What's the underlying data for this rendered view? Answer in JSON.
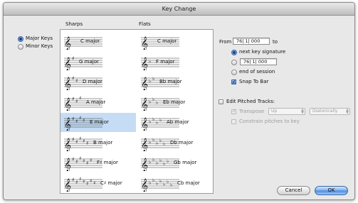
{
  "window": {
    "title": "Key Change"
  },
  "mode": {
    "options": [
      {
        "label": "Major Keys",
        "selected": true
      },
      {
        "label": "Minor Keys",
        "selected": false
      }
    ]
  },
  "list": {
    "headers": {
      "sharps": "Sharps",
      "flats": "Flats"
    },
    "sharps": [
      {
        "label": "C major",
        "accidentals": 0,
        "selected": false
      },
      {
        "label": "G major",
        "accidentals": 1,
        "selected": false
      },
      {
        "label": "D major",
        "accidentals": 2,
        "selected": false
      },
      {
        "label": "A major",
        "accidentals": 3,
        "selected": false
      },
      {
        "label": "E major",
        "accidentals": 4,
        "selected": true
      },
      {
        "label": "B major",
        "accidentals": 5,
        "selected": false
      },
      {
        "label": "F♯ major",
        "accidentals": 6,
        "selected": false
      },
      {
        "label": "C♯ major",
        "accidentals": 7,
        "selected": false
      }
    ],
    "flats": [
      {
        "label": "C major",
        "accidentals": 0,
        "selected": false
      },
      {
        "label": "F major",
        "accidentals": 1,
        "selected": false
      },
      {
        "label": "Bb major",
        "accidentals": 2,
        "selected": false
      },
      {
        "label": "Eb major",
        "accidentals": 3,
        "selected": false
      },
      {
        "label": "Ab major",
        "accidentals": 4,
        "selected": false
      },
      {
        "label": "Db major",
        "accidentals": 5,
        "selected": false
      },
      {
        "label": "Gb major",
        "accidentals": 6,
        "selected": false
      },
      {
        "label": "Cb major",
        "accidentals": 7,
        "selected": false
      }
    ],
    "sharp_symbol": "♯",
    "flat_symbol": "♭",
    "clef_symbol": "𝄞",
    "selection_color": "#c5dcf4"
  },
  "range": {
    "from_label": "From",
    "from_value": "76| 1| 000",
    "to_label": "to",
    "to_options": [
      {
        "label": "next key signature",
        "selected": true
      },
      {
        "label": "",
        "value": "76| 1| 000",
        "selected": false
      },
      {
        "label": "end of session",
        "selected": false
      }
    ],
    "snap_label": "Snap To Bar",
    "snap_checked": true
  },
  "pitched": {
    "edit_label": "Edit Pitched Tracks:",
    "edit_checked": false,
    "transpose_label": "Transpose",
    "transpose_checked": true,
    "direction_value": "Up",
    "method_value": "Diatonically",
    "constrain_label": "Constrain pitches to key",
    "constrain_checked": false
  },
  "buttons": {
    "cancel": "Cancel",
    "ok": "OK"
  },
  "accent_color": "#3d78c8"
}
